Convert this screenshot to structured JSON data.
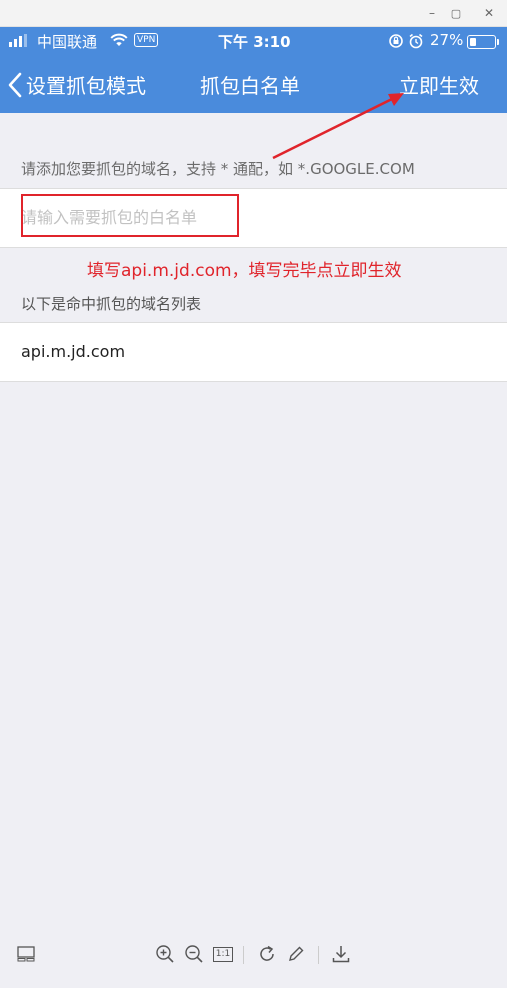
{
  "window": {
    "minimize_glyph": "–",
    "maximize_glyph": "▢",
    "close_glyph": "✕"
  },
  "status_bar": {
    "carrier": "中国联通",
    "vpn": "VPN",
    "time": "下午 3:10",
    "battery_percent": "27%",
    "battery_level": 0.27,
    "icons": [
      "signal-icon",
      "wifi-icon",
      "rotation-lock-icon",
      "alarm-icon",
      "battery-icon"
    ]
  },
  "nav": {
    "back_label": "设置抓包模式",
    "title": "抓包白名单",
    "action_label": "立即生效"
  },
  "hint": "请添加您要抓包的域名，支持 * 通配，如 *.GOOGLE.COM",
  "input": {
    "placeholder": "请输入需要抓包的白名单",
    "value": ""
  },
  "annotation": "填写api.m.jd.com，填写完毕点立即生效",
  "list_header": "以下是命中抓包的域名列表",
  "domains": [
    "api.m.jd.com"
  ],
  "colors": {
    "nav_blue": "#4a8bdc",
    "annotation_red": "#e0242b",
    "background": "#efeff4"
  },
  "toolbar_icons": [
    "layout-icon",
    "zoom-in-icon",
    "zoom-out-icon",
    "actual-size-icon",
    "rotate-icon",
    "edit-icon",
    "download-icon"
  ],
  "toolbar": {
    "actual_size_label": "1:1"
  }
}
